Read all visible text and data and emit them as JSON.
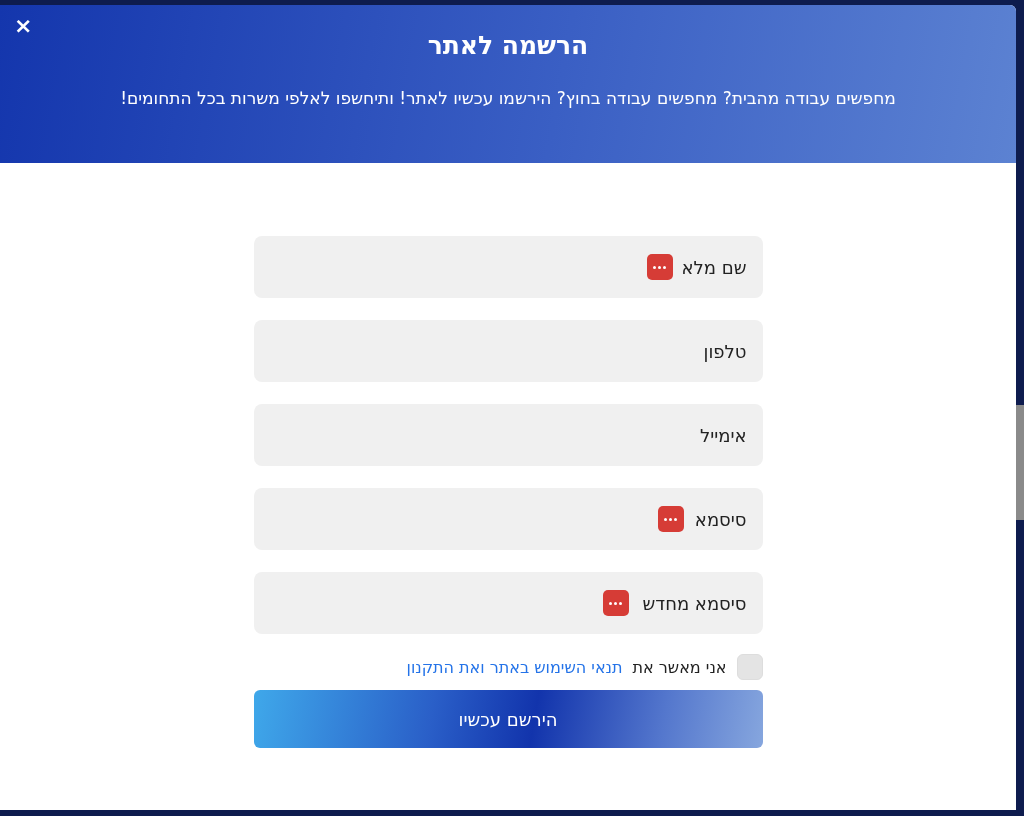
{
  "dialog": {
    "close": "×",
    "title": "הרשמה לאתר",
    "subtitle": "מחפשים עבודה מהבית? מחפשים עבודה בחוץ? הירשמו עכשיו לאתר! ותיחשפו לאלפי משרות בכל התחומים!"
  },
  "fields": [
    {
      "placeholder": "שם מלא",
      "autofill_badge": true
    },
    {
      "placeholder": "טלפון",
      "autofill_badge": false
    },
    {
      "placeholder": "אימייל",
      "autofill_badge": false
    },
    {
      "placeholder": "סיסמא",
      "autofill_badge": true
    },
    {
      "placeholder": "סיסמא מחדש",
      "autofill_badge": true
    }
  ],
  "terms": {
    "checked": false,
    "text": "אני מאשר את",
    "link": "תנאי השימוש באתר ואת התקנון"
  },
  "submit": "הירשם עכשיו"
}
